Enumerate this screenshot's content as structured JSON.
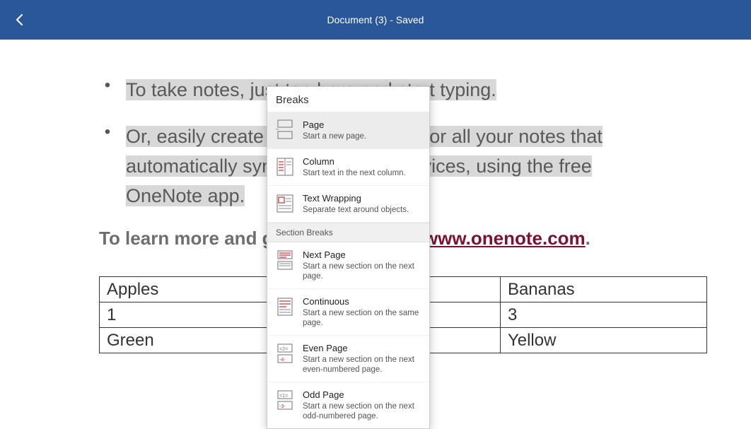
{
  "header": {
    "title": "Document (3) - Saved"
  },
  "content": {
    "bullet1": "To take notes, just tap here and start typing.",
    "bullet2_a": "Or, easily create a digital notebook for all your notes that",
    "bullet2_b": "automatically syncs across your devices, using the free",
    "bullet2_c": "OneNote app.",
    "learn_prefix": "To learn more and get OneNote, visit ",
    "learn_link": "www.onenote.com",
    "learn_suffix": "."
  },
  "table": {
    "r0": {
      "c0": "Apples",
      "c1": "",
      "c2": "Bananas"
    },
    "r1": {
      "c0": "1",
      "c1": "",
      "c2": "3"
    },
    "r2": {
      "c0": "Green",
      "c1": "",
      "c2": "Yellow"
    }
  },
  "menu": {
    "title": "Breaks",
    "page_t": "Page",
    "page_d": "Start a new page.",
    "col_t": "Column",
    "col_d": "Start text in the next column.",
    "wrap_t": "Text Wrapping",
    "wrap_d": "Separate text around objects.",
    "section_header": "Section Breaks",
    "next_t": "Next Page",
    "next_d": "Start a new section on the next page.",
    "cont_t": "Continuous",
    "cont_d": "Start a new section on the same page.",
    "even_t": "Even Page",
    "even_d": "Start a new section on the next even-numbered page.",
    "odd_t": "Odd Page",
    "odd_d": "Start a new section on the next odd-numbered page."
  }
}
